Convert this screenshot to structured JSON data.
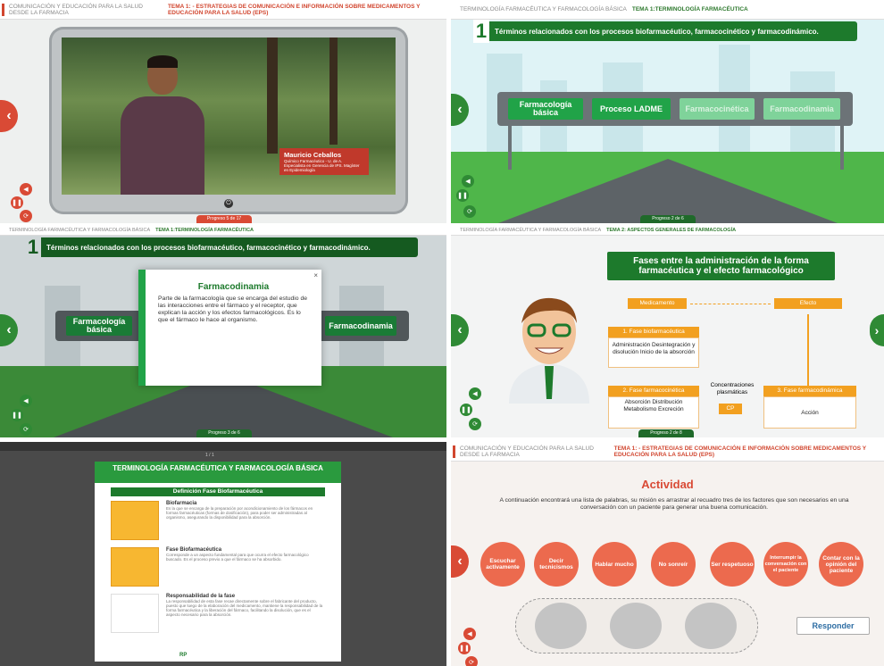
{
  "panel1": {
    "breadcrumb": "COMUNICACIÓN Y EDUCACIÓN PARA LA SALUD DESDE LA FARMACIA",
    "topic": "TEMA 1: - ESTRATEGIAS DE COMUNICACIÓN E INFORMACIÓN SOBRE MEDICAMENTOS Y EDUCACIÓN PARA LA SALUD (EPS)",
    "presenter_name": "Mauricio Ceballos",
    "presenter_role": "Químico Farmacéutico - U. de A. Especialista en Gerencia de IPS. Magíster en Epidemiología",
    "progress": "Progreso 5 de 17"
  },
  "panel2": {
    "breadcrumb": "TERMINOLOGÍA FARMACÉUTICA Y FARMACOLOGÍA BÁSICA",
    "topic": "TEMA 1:TERMINOLOGÍA FARMACÉUTICA",
    "num": "1",
    "banner": "Términos relacionados con los procesos biofarmacéutico, farmacocinético y farmacodinámico.",
    "signs": [
      "Farmacología básica",
      "Proceso LADME",
      "Farmacocinética",
      "Farmacodinamia"
    ],
    "progress": "Progreso 2 de 6"
  },
  "panel3": {
    "breadcrumb": "TERMINOLOGÍA FARMACÉUTICA Y FARMACOLOGÍA BÁSICA",
    "topic": "TEMA 1:TERMINOLOGÍA FARMACÉUTICA",
    "num": "1",
    "banner": "Términos relacionados con los procesos biofarmacéutico, farmacocinético y farmacodinámico.",
    "sign_left": "Farmacología básica",
    "sign_right": "Farmacodinamia",
    "modal_title": "Farmacodinamia",
    "modal_text": "Parte de la farmacología que se encarga del estudio de las interacciones entre el fármaco y el receptor, que explican la acción y los efectos farmacológicos. Es lo que el fármaco le hace al organismo.",
    "modal_close": "×",
    "progress": "Progreso 3 de 6"
  },
  "panel4": {
    "breadcrumb": "TERMINOLOGÍA FARMACÉUTICA Y FARMACOLOGÍA BÁSICA",
    "topic": "TEMA 2: ASPECTOS GENERALES DE FARMACOLOGÍA",
    "title": "Fases entre la administración de la forma farmacéutica y el efecto farmacológico",
    "medicamento": "Medicamento",
    "efecto": "Efecto",
    "fase1": "1. Fase biofarmacéutica",
    "fase1_items": "Administración Desintegración y disolución Inicio de la absorción",
    "fase2": "2. Fase farmacocinética",
    "fase2_items": "Absorción Distribución Metabolismo Excreción",
    "conc": "Concentraciones plasmáticas",
    "cp": "CP",
    "fase3": "3. Fase farmacodinámica",
    "accion": "Acción",
    "progress": "Progreso 2 de 8"
  },
  "panel5": {
    "pager": "1 / 1",
    "header": "TERMINOLOGÍA FARMACÉUTICA Y FARMACOLOGÍA BÁSICA",
    "sub": "Definición Fase Biofarmacéutica",
    "rows": [
      {
        "title": "Biofarmacia",
        "text": "Es la que se encarga de la preparación por acondicionamiento de los fármacos en formas farmacéuticas (formas de dosificación), para poder ser administradas al organismo, asegurando la disponibilidad para la absorción."
      },
      {
        "title": "Fase Biofarmacéutica",
        "text": "Corresponde a un aspecto fundamental para que ocurra el efecto farmacológico buscado. Es el proceso previo a que el fármaco se ha absorbido."
      },
      {
        "title": "Responsabilidad de la fase",
        "text": "La responsabilidad de esta fase recae directamente sobre el fabricante del producto, puesto que luego de la elaboración del medicamento, mantiene la responsabilidad de la forma farmacéutica y la liberación del fármaco, facilitando la disolución, que es el aspecto necesario para la absorción."
      }
    ],
    "footer": "RP"
  },
  "panel6": {
    "breadcrumb": "COMUNICACIÓN Y EDUCACIÓN PARA LA SALUD DESDE LA FARMACIA",
    "topic": "TEMA 1: - ESTRATEGIAS DE COMUNICACIÓN E INFORMACIÓN SOBRE MEDICAMENTOS Y EDUCACIÓN PARA LA SALUD (EPS)",
    "title": "Actividad",
    "desc": "A continuación encontrará una lista de palabras, su misión es arrastrar al recuadro tres de los factores que son necesarios en una conversación con un paciente para generar una buena comunicación.",
    "options": [
      "Escuchar activamente",
      "Decir tecnicismos",
      "Hablar mucho",
      "No sonreír",
      "Ser respetuoso",
      "Interrumpir la conversación con el paciente",
      "Contar con la opinión del paciente"
    ],
    "respond": "Responder"
  }
}
